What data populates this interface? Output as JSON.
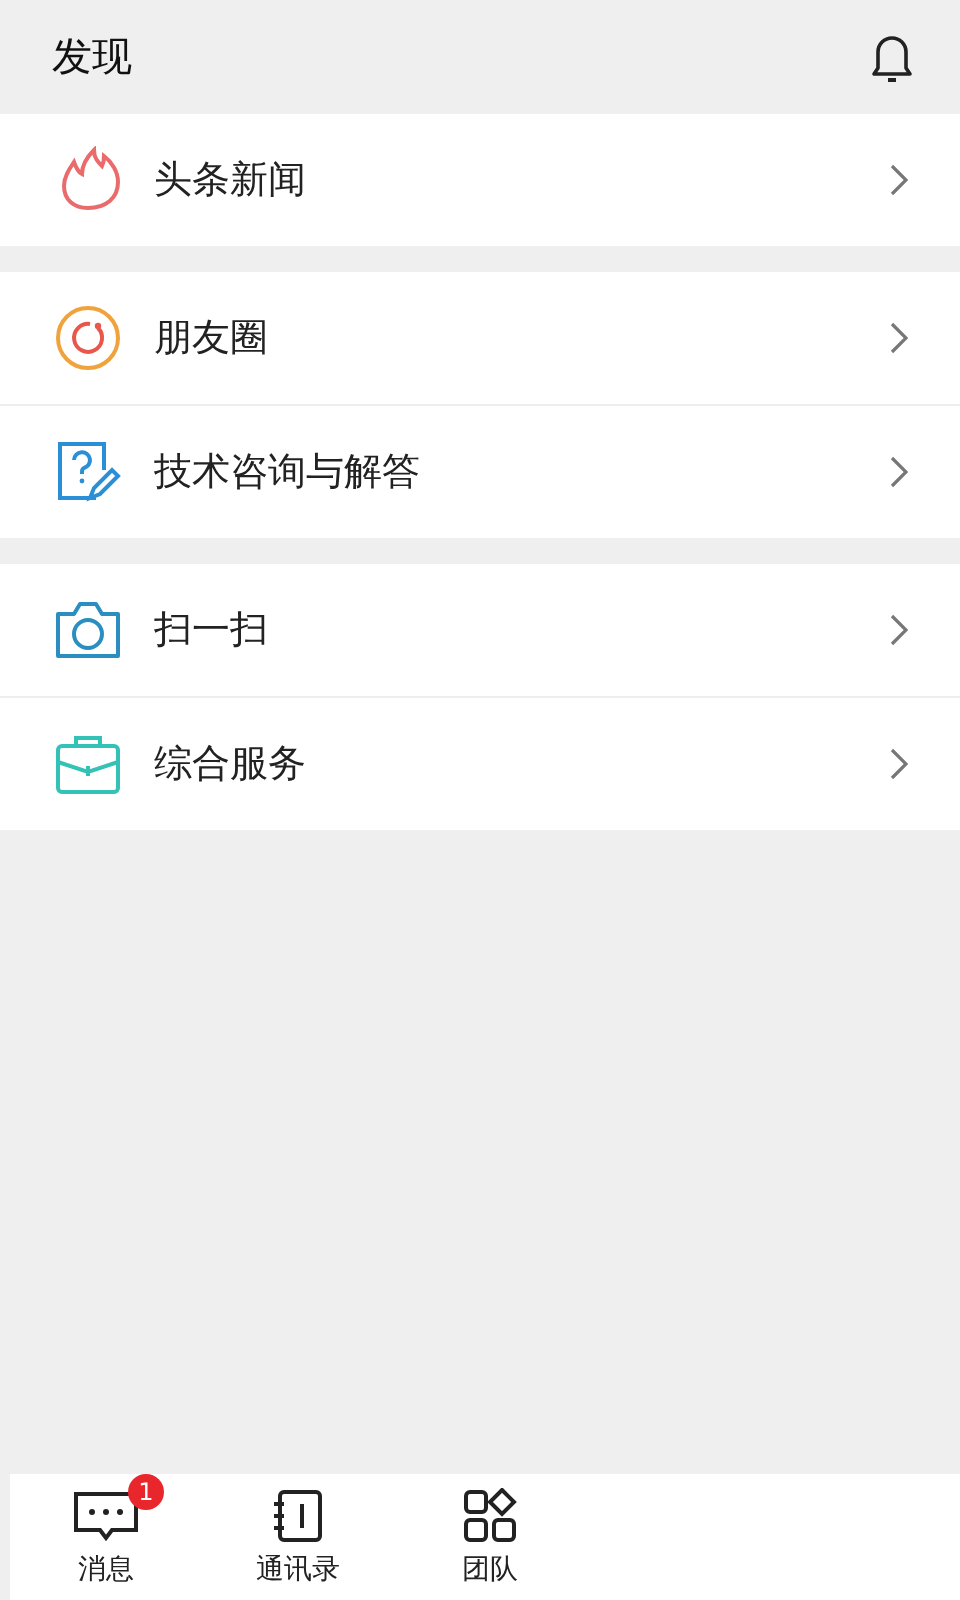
{
  "header": {
    "title": "发现"
  },
  "groups": [
    {
      "items": [
        {
          "label": "头条新闻"
        }
      ]
    },
    {
      "items": [
        {
          "label": "朋友圈"
        },
        {
          "label": "技术咨询与解答"
        }
      ]
    },
    {
      "items": [
        {
          "label": "扫一扫"
        },
        {
          "label": "综合服务"
        }
      ]
    }
  ],
  "tab_bar": {
    "tabs": [
      {
        "label": "消息",
        "badge": "1"
      },
      {
        "label": "通讯录"
      },
      {
        "label": "团队"
      }
    ]
  }
}
